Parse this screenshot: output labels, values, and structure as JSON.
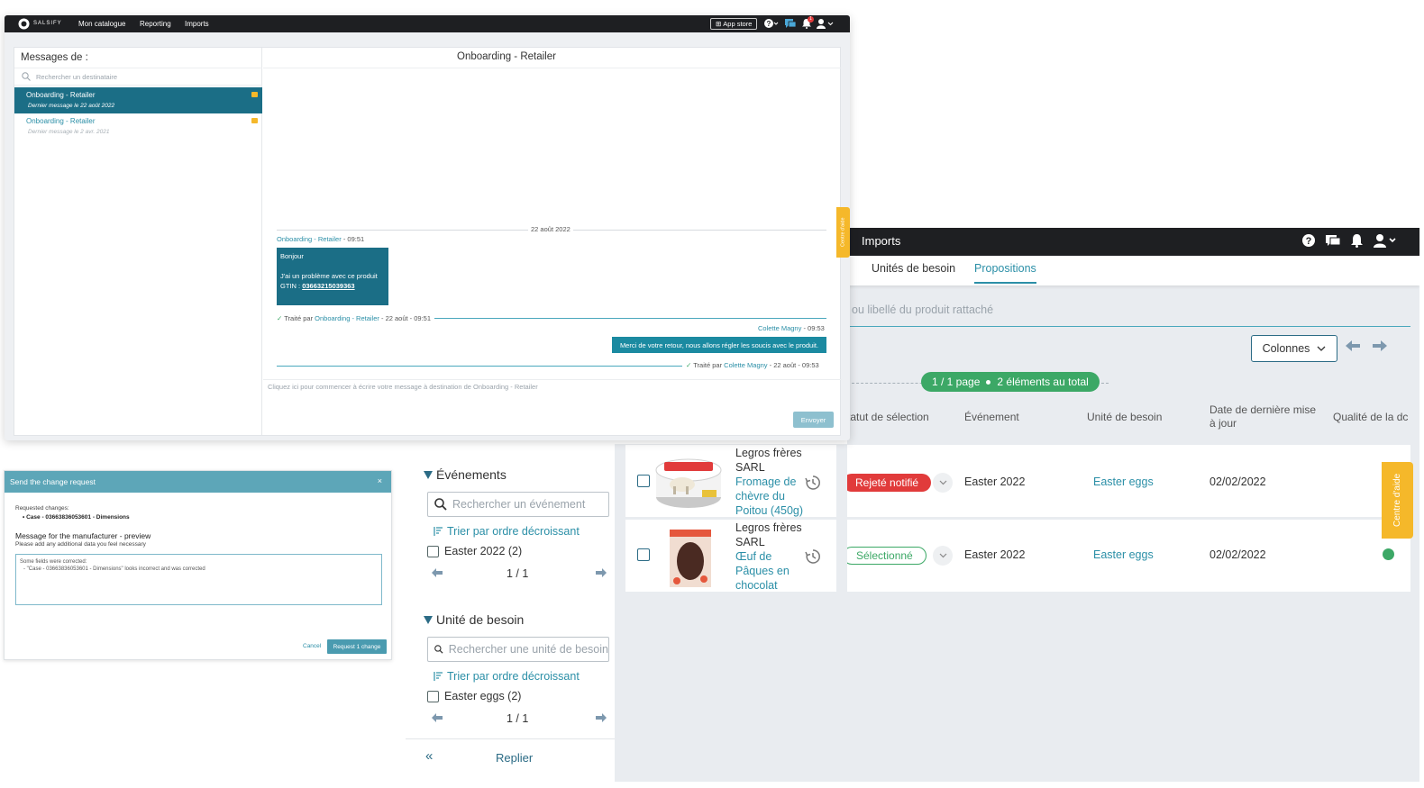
{
  "messages_window": {
    "nav": {
      "brand": "SALSIFY",
      "items": [
        "Mon catalogue",
        "Reporting",
        "Imports"
      ],
      "app_store": "App store",
      "notification_count": "1"
    },
    "left": {
      "header": "Messages de :",
      "search_placeholder": "Rechercher un destinataire",
      "conversations": [
        {
          "title": "Onboarding - Retailer",
          "date": "Dernier message le 22 août 2022"
        },
        {
          "title": "Onboarding - Retailer",
          "date": "Dernier message le 2 avr. 2021"
        }
      ]
    },
    "chat": {
      "title": "Onboarding - Retailer",
      "date_divider": "22 août 2022",
      "msg1_sender": "Onboarding - Retailer",
      "msg1_time": "- 09:51",
      "msg1_line1": "Bonjour",
      "msg1_line2": "J'ai un problème  avec ce produit",
      "msg1_gtin_label": "GTIN :",
      "msg1_gtin": "03663215039363",
      "treated1_prefix": "Traité par",
      "treated1_by": "Onboarding - Retailer",
      "treated1_suffix": "- 22 août - 09:51",
      "msg2_sender": "Colette Magny",
      "msg2_time": "- 09:53",
      "msg2_text": "Merci de votre retour, nous allons régler les soucis avec le produit.",
      "treated2_prefix": "Traité par",
      "treated2_by": "Colette Magny",
      "treated2_suffix": "- 22 août - 09:53",
      "compose_placeholder": "Cliquez ici pour commencer à écrire votre message à destination de Onboarding - Retailer",
      "send_label": "Envoyer",
      "help_tab": "Centre d'aide"
    }
  },
  "dialog": {
    "title": "Send the change request",
    "close": "×",
    "requested_label": "Requested changes:",
    "requested_item": "Case - 03663836053601 - Dimensions",
    "message_title": "Message for the manufacturer - preview",
    "message_hint": "Please add any additional data you feel necessary",
    "textarea_line1": "Some fields were corrected:",
    "textarea_line2": "- \"Case - 03663836053601 - Dimensions\" looks incorrect and was corrected",
    "cancel": "Cancel",
    "submit": "Request 1 change"
  },
  "props_window": {
    "topbar_title": "Imports",
    "tabs": [
      "Unités de besoin",
      "Propositions"
    ],
    "active_tab": 1,
    "search_placeholder": "ou libellé du produit rattaché",
    "columns_button": "Colonnes",
    "pager_pages": "1 / 1 page",
    "pager_total": "2 éléments au total",
    "headers": {
      "status": "tatut de sélection",
      "event": "Événement",
      "unit": "Unité de besoin",
      "date_line1": "Date de dernière mise",
      "date_line2": "à jour",
      "quality": "Qualité de la dc"
    },
    "rows": [
      {
        "supplier_line1": "Legros frères",
        "supplier_line2": "SARL",
        "product": [
          "Fromage de",
          "chèvre du",
          "Poitou (450g)"
        ],
        "status": "Rejeté notifié",
        "event": "Easter 2022",
        "unit": "Easter eggs",
        "date": "02/02/2022"
      },
      {
        "supplier_line1": "Legros frères",
        "supplier_line2": "SARL",
        "product": [
          "Œuf de",
          "Pâques en",
          "chocolat"
        ],
        "status": "Sélectionné",
        "event": "Easter 2022",
        "unit": "Easter eggs",
        "date": "02/02/2022"
      }
    ],
    "help_tab": "Centre d'aide"
  },
  "filters": {
    "events_title": "Événements",
    "events_search": "Rechercher un événement",
    "events_sort": "Trier par ordre décroissant",
    "events_item": "Easter 2022 (2)",
    "events_pager": "1 / 1",
    "units_title": "Unité de besoin",
    "units_search": "Rechercher une unité de besoin",
    "units_sort": "Trier par ordre décroissant",
    "units_item": "Easter eggs (2)",
    "units_pager": "1 / 1",
    "collapse": "Replier",
    "collapse_icon": "«"
  },
  "colors": {
    "accent": "#2b8fa7",
    "dark_teal": "#1b6e86",
    "green": "#3ca866",
    "red": "#e13b3b",
    "help_yellow": "#f5b82a"
  }
}
